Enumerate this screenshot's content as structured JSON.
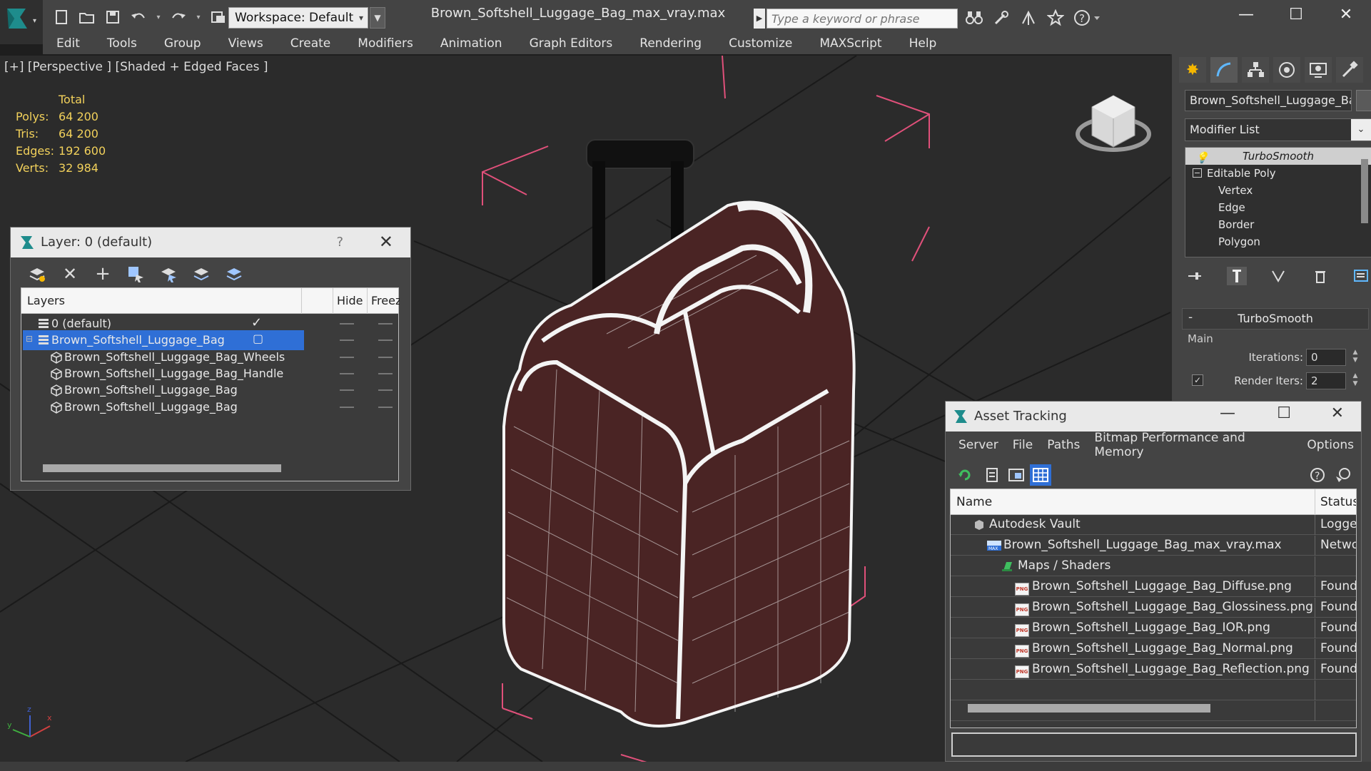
{
  "app": {
    "document_title": "Brown_Softshell_Luggage_Bag_max_vray.max",
    "workspace_label": "Workspace: Default",
    "search_placeholder": "Type a keyword or phrase"
  },
  "menus": [
    "Edit",
    "Tools",
    "Group",
    "Views",
    "Create",
    "Modifiers",
    "Animation",
    "Graph Editors",
    "Rendering",
    "Customize",
    "MAXScript",
    "Help"
  ],
  "viewport": {
    "label": "[+] [Perspective ] [Shaded + Edged Faces ]",
    "stats": {
      "header": "Total",
      "rows": [
        {
          "key": "Polys:",
          "value": "64 200"
        },
        {
          "key": "Tris:",
          "value": "64 200"
        },
        {
          "key": "Edges:",
          "value": "192 600"
        },
        {
          "key": "Verts:",
          "value": "32 984"
        }
      ]
    }
  },
  "layer_dialog": {
    "title": "Layer: 0 (default)",
    "help": "?",
    "columns": {
      "layers": "Layers",
      "hide": "Hide",
      "freeze": "Freez"
    },
    "rows": [
      {
        "name": "0 (default)",
        "level": 0,
        "type": "layer",
        "active": true
      },
      {
        "name": "Brown_Softshell_Luggage_Bag",
        "level": 0,
        "type": "layer",
        "selected": true
      },
      {
        "name": "Brown_Softshell_Luggage_Bag_Wheels",
        "level": 1,
        "type": "object"
      },
      {
        "name": "Brown_Softshell_Luggage_Bag_Handle",
        "level": 1,
        "type": "object"
      },
      {
        "name": "Brown_Softshell_Luggage_Bag",
        "level": 1,
        "type": "object"
      },
      {
        "name": "Brown_Softshell_Luggage_Bag",
        "level": 1,
        "type": "object"
      }
    ]
  },
  "command_panel": {
    "object_name": "Brown_Softshell_Luggage_Bag",
    "modifier_list": "Modifier List",
    "stack": {
      "top": "TurboSmooth",
      "base": "Editable Poly",
      "subobjects": [
        "Vertex",
        "Edge",
        "Border",
        "Polygon"
      ]
    },
    "rollout": {
      "title": "TurboSmooth",
      "group": "Main",
      "iterations_label": "Iterations:",
      "iterations_value": "0",
      "render_iters_label": "Render Iters:",
      "render_iters_value": "2",
      "render_iters_checked": true
    }
  },
  "asset_tracking": {
    "title": "Asset Tracking",
    "menus": [
      "Server",
      "File",
      "Paths",
      "Bitmap Performance and Memory",
      "Options"
    ],
    "columns": {
      "name": "Name",
      "status": "Status"
    },
    "rows": [
      {
        "name": "Autodesk Vault",
        "status": "Logged",
        "level": 0,
        "icon": "vault"
      },
      {
        "name": "Brown_Softshell_Luggage_Bag_max_vray.max",
        "status": "Network",
        "level": 1,
        "icon": "max"
      },
      {
        "name": "Maps / Shaders",
        "status": "",
        "level": 2,
        "icon": "maps"
      },
      {
        "name": "Brown_Softshell_Luggage_Bag_Diffuse.png",
        "status": "Found",
        "level": 3,
        "icon": "png"
      },
      {
        "name": "Brown_Softshell_Luggage_Bag_Glossiness.png",
        "status": "Found",
        "level": 3,
        "icon": "png"
      },
      {
        "name": "Brown_Softshell_Luggage_Bag_IOR.png",
        "status": "Found",
        "level": 3,
        "icon": "png"
      },
      {
        "name": "Brown_Softshell_Luggage_Bag_Normal.png",
        "status": "Found",
        "level": 3,
        "icon": "png"
      },
      {
        "name": "Brown_Softshell_Luggage_Bag_Reflection.png",
        "status": "Found",
        "level": 3,
        "icon": "png"
      }
    ]
  },
  "colors": {
    "selection": "#2f6fd6",
    "stats_text": "#f2d15b",
    "bounding_box": "#e0507a",
    "bag_fill": "#4a2424"
  }
}
